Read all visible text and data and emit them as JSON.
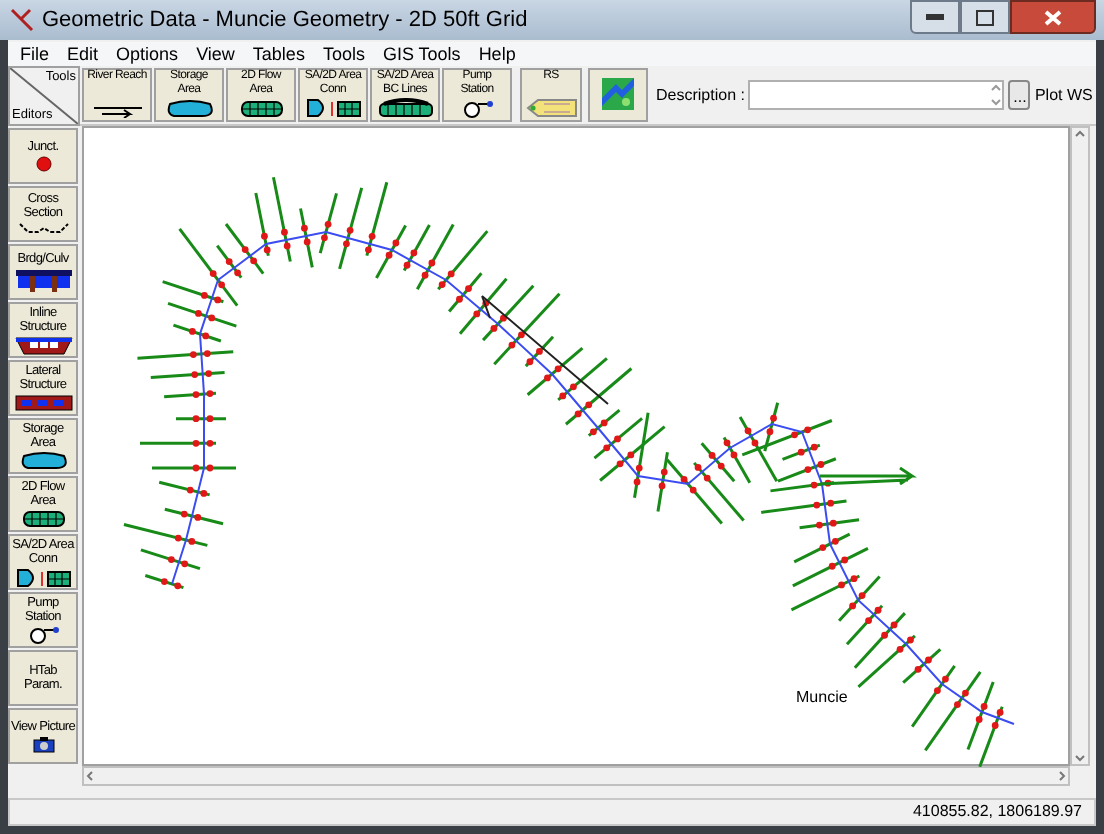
{
  "window": {
    "title": "Geometric Data - Muncie Geometry - 2D 50ft Grid"
  },
  "menu": [
    "File",
    "Edit",
    "Options",
    "View",
    "Tables",
    "Tools",
    "GIS Tools",
    "Help"
  ],
  "palette_header": {
    "tools": "Tools",
    "editors": "Editors"
  },
  "tools": [
    {
      "kind": "reach",
      "label": "River Reach"
    },
    {
      "kind": "storage",
      "label": "Storage Area"
    },
    {
      "kind": "flow2d",
      "label": "2D Flow Area"
    },
    {
      "kind": "connection",
      "label": "SA/2D Area Conn"
    },
    {
      "kind": "bc_line",
      "label": "SA/2D Area BC Lines"
    },
    {
      "kind": "pump",
      "label": "Pump Station"
    },
    {
      "kind": "rs",
      "label": "RS"
    },
    {
      "kind": "map"
    }
  ],
  "description": {
    "label": "Description :",
    "button": "...",
    "plot": "Plot WS"
  },
  "editors": [
    {
      "kind": "junction",
      "label": "Junct."
    },
    {
      "kind": "cross_section",
      "label": "Cross Section"
    },
    {
      "kind": "bridge",
      "label": "Brdg/Culv"
    },
    {
      "kind": "inline",
      "label": "Inline Structure"
    },
    {
      "kind": "lateral",
      "label": "Lateral Structure"
    },
    {
      "kind": "storage",
      "label": "Storage Area"
    },
    {
      "kind": "flow2d",
      "label": "2D Flow Area"
    },
    {
      "kind": "connection",
      "label": "SA/2D Area Conn"
    },
    {
      "kind": "pump",
      "label": "Pump Station"
    },
    {
      "kind": "plain",
      "label": "HTab Param."
    },
    {
      "kind": "picture",
      "label": "View Picture"
    }
  ],
  "map": {
    "label": "Muncie"
  },
  "status_bar": {
    "coordinates": "410855.82, 1806189.97"
  }
}
